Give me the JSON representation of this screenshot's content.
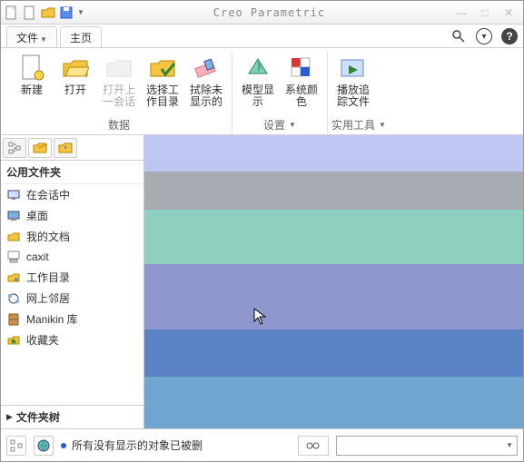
{
  "app": {
    "title": "Creo Parametric"
  },
  "tabs": {
    "file": "文件",
    "home": "主页"
  },
  "ribbon": {
    "new": "新建",
    "open": "打开",
    "open_last": "打开上一会话",
    "select_wd": "选择工作目录",
    "erase": "拭除未显示的",
    "model_disp": "模型显示",
    "sys_colors": "系统颜色",
    "play_trail": "播放追踪文件",
    "group_data": "数据",
    "group_settings": "设置",
    "group_util": "实用工具"
  },
  "sidebar": {
    "header": "公用文件夹",
    "items": [
      {
        "label": "在会话中"
      },
      {
        "label": "桌面"
      },
      {
        "label": "我的文档"
      },
      {
        "label": "caxit"
      },
      {
        "label": "工作目录"
      },
      {
        "label": "网上邻居"
      },
      {
        "label": "Manikin 库"
      },
      {
        "label": "收藏夹"
      }
    ],
    "footer": "文件夹树"
  },
  "status": {
    "msg": "所有没有显示的对象已被删"
  }
}
